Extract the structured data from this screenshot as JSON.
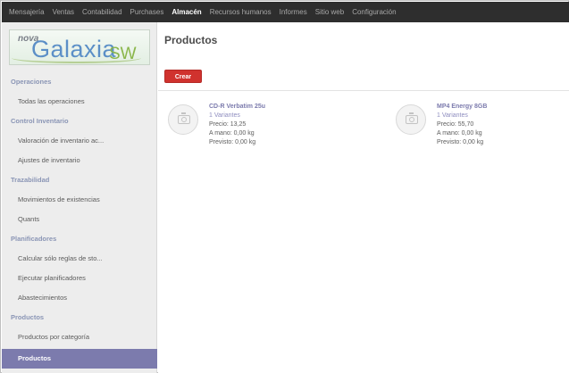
{
  "topbar": {
    "menus": [
      {
        "label": "Mensajería",
        "active": false
      },
      {
        "label": "Ventas",
        "active": false
      },
      {
        "label": "Contabilidad",
        "active": false
      },
      {
        "label": "Purchases",
        "active": false
      },
      {
        "label": "Almacén",
        "active": true
      },
      {
        "label": "Recursos humanos",
        "active": false
      },
      {
        "label": "Informes",
        "active": false
      },
      {
        "label": "Sitio web",
        "active": false
      },
      {
        "label": "Configuración",
        "active": false
      }
    ]
  },
  "logo": {
    "word_top": "nova",
    "word_main": "Galaxia",
    "word_suffix": "SW"
  },
  "sidebar": {
    "sections": [
      {
        "title": "Operaciones",
        "items": [
          "Todas las operaciones"
        ]
      },
      {
        "title": "Control Inventario",
        "items": [
          "Valoración de inventario ac...",
          "Ajustes de inventario"
        ]
      },
      {
        "title": "Trazabilidad",
        "items": [
          "Movimientos de existencias",
          "Quants"
        ]
      },
      {
        "title": "Planificadores",
        "items": [
          "Calcular sólo reglas de sto...",
          "Ejecutar planificadores",
          "Abastecimientos"
        ]
      },
      {
        "title": "Productos",
        "items": [
          "Productos por categoría",
          "Productos"
        ]
      }
    ],
    "selected_item": "Productos"
  },
  "main": {
    "title": "Productos",
    "create_label": "Crear",
    "products": [
      {
        "name": "CD-R Verbatim 25u",
        "variants": "1 Variantes",
        "price": "Precio: 13,25",
        "on_hand": "A mano: 0,00 kg",
        "forecast": "Previsto: 0,00 kg",
        "image_icon": "camera-placeholder-icon"
      },
      {
        "name": "MP4 Energy 8GB",
        "variants": "1 Variantes",
        "price": "Precio: 55,70",
        "on_hand": "A mano: 0,00 kg",
        "forecast": "Previsto: 0,00 kg",
        "image_icon": "camera-placeholder-icon"
      }
    ]
  },
  "colors": {
    "topbar_bg": "#2e2e2e",
    "sidebar_bg": "#ededed",
    "accent": "#7c7bad",
    "create_button": "#d0322e"
  }
}
